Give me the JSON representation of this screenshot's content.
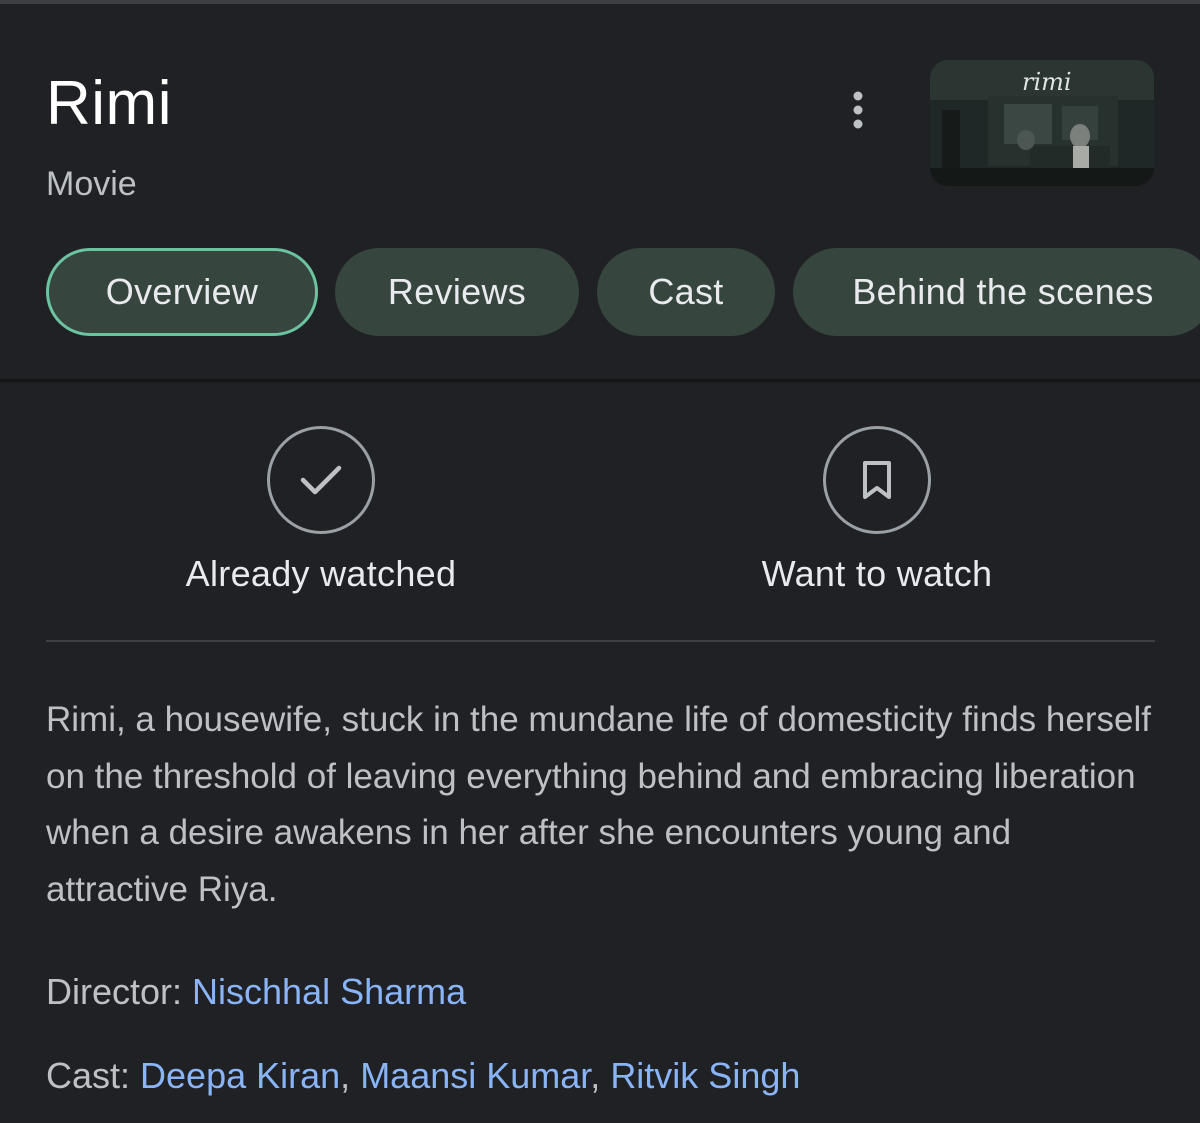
{
  "header": {
    "title": "Rimi",
    "subtitle": "Movie",
    "more_icon": "more-vert-icon",
    "thumbnail_text": "rimi"
  },
  "tabs": [
    {
      "label": "Overview",
      "active": true
    },
    {
      "label": "Reviews",
      "active": false
    },
    {
      "label": "Cast",
      "active": false
    },
    {
      "label": "Behind the scenes",
      "active": false
    }
  ],
  "actions": {
    "watched": {
      "label": "Already watched",
      "icon": "check-icon"
    },
    "want": {
      "label": "Want to watch",
      "icon": "bookmark-icon"
    }
  },
  "description": "Rimi, a housewife, stuck in the mundane life of domesticity finds herself on the threshold of leaving everything behind and embracing liberation when a desire awakens in her after she encounters young and attractive Riya.",
  "details": {
    "director_label": "Director: ",
    "director": "Nischhal Sharma",
    "cast_label": "Cast: ",
    "cast": [
      "Deepa Kiran",
      "Maansi Kumar",
      "Ritvik Singh"
    ],
    "cast_separator": ", "
  },
  "colors": {
    "background": "#202124",
    "tab_fill": "#36463f",
    "tab_active_border": "#6cc3a0",
    "link": "#8ab4f8"
  }
}
